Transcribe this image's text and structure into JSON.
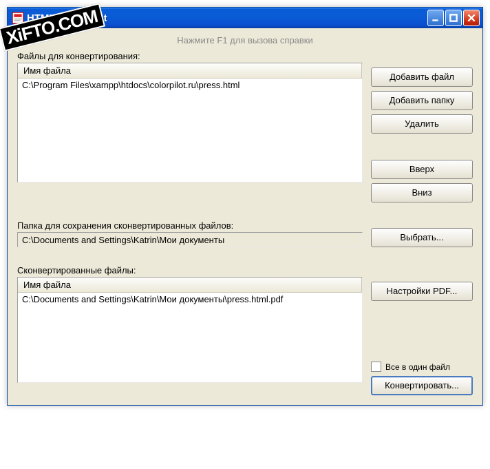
{
  "window": {
    "title": "HTML2PDF Pilot"
  },
  "helpText": "Нажмите F1 для вызова справки",
  "filesSection": {
    "label": "Файлы для конвертирования:",
    "columnHeader": "Имя файла",
    "rows": [
      "C:\\Program Files\\xampp\\htdocs\\colorpilot.ru\\press.html"
    ]
  },
  "buttons": {
    "addFile": "Добавить файл",
    "addFolder": "Добавить папку",
    "delete": "Удалить",
    "up": "Вверх",
    "down": "Вниз",
    "browse": "Выбрать...",
    "pdfSettings": "Настройки PDF...",
    "convert": "Конвертировать..."
  },
  "saveFolder": {
    "label": "Папка для сохранения сконвертированных файлов:",
    "value": "C:\\Documents and Settings\\Katrin\\Мои документы"
  },
  "convertedSection": {
    "label": "Сконвертированные файлы:",
    "columnHeader": "Имя файла",
    "rows": [
      "C:\\Documents and Settings\\Katrin\\Мои документы\\press.html.pdf"
    ]
  },
  "checkbox": {
    "label": "Все в один файл"
  },
  "watermark": "XiFTO.COM"
}
